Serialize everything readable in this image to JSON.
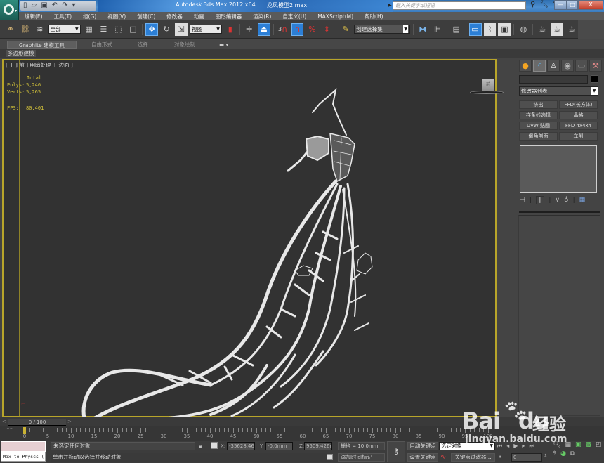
{
  "titlebar": {
    "window_title": "Autodesk 3ds Max  2012 x64",
    "document_title": "龙凤模型2.max",
    "search_placeholder": "键入关键字或短语",
    "quick_access": [
      "new-icon",
      "open-icon",
      "save-icon",
      "undo-icon",
      "redo-icon",
      "customize-icon"
    ],
    "info_icons": [
      "binoculars-icon",
      "wrench-icon",
      "exchange-icon",
      "star-icon",
      "help-icon"
    ],
    "window_controls": {
      "minimize": "—",
      "maximize": "□",
      "close": "X"
    }
  },
  "menu": [
    "编辑(E)",
    "工具(T)",
    "组(G)",
    "视图(V)",
    "创建(C)",
    "修改器",
    "动画",
    "图形编辑器",
    "渲染(R)",
    "自定义(U)",
    "MAXScript(M)",
    "帮助(H)"
  ],
  "toolbar": {
    "selection_filter": "全部",
    "reference_coord": "视图",
    "named_selection": "创建选择集",
    "snap_label": "3"
  },
  "ribbon": {
    "tabs": [
      "Graphite 建模工具",
      "自由形式",
      "选择",
      "对象绘制"
    ],
    "panel_label": "多边形建模"
  },
  "viewport": {
    "label": "[ + ] 前 ] 明暗处理 + 边面 ]",
    "stats": {
      "header": "Total",
      "polys_label": "Polys:",
      "polys": "5,246",
      "verts_label": "Verts:",
      "verts": "5,265",
      "fps_label": "FPS:",
      "fps": "80.401"
    },
    "viewcube_face": "前",
    "model": "dragon-phoenix wireframe"
  },
  "command_panel": {
    "tabs": [
      "create-icon",
      "modify-icon",
      "hierarchy-icon",
      "motion-icon",
      "display-icon",
      "utilities-icon"
    ],
    "object_name": "",
    "modifier_list": "修改器列表",
    "modifier_buttons": [
      "挤出",
      "FFD(长方体)",
      "样条线选择",
      "晶格",
      "UVW 贴图",
      "FFD 4x4x4",
      "倒角剖面",
      "车削"
    ],
    "stack_tools": [
      "pin-stack-icon",
      "show-end-result-icon",
      "make-unique-icon",
      "remove-modifier-icon",
      "configure-sets-icon"
    ]
  },
  "time_slider": {
    "label": "0 / 100",
    "current": 0,
    "total": 100
  },
  "trackbar": {
    "ticks": [
      "0",
      "5",
      "10",
      "15",
      "20",
      "25",
      "30",
      "35",
      "40",
      "45",
      "50",
      "55",
      "60",
      "65",
      "70",
      "75",
      "80",
      "85",
      "90",
      "95",
      "100"
    ]
  },
  "status": {
    "maxscript_text": "Max to Physcs (",
    "selection_status": "未选定任何对象",
    "prompt": "单击并拖动以选择并移动对象",
    "x_label": "X:",
    "x_value": "-35628.46",
    "y_label": "Y:",
    "y_value": "-0.0mm",
    "z_label": "Z:",
    "z_value": "9509.426m",
    "grid": "栅格 = 10.0mm",
    "add_time_tag": "添加时间标记",
    "auto_key": "自动关键点",
    "set_key": "设置关键点",
    "selected_dropdown": "选定对象",
    "key_filters": "关键点过滤器...",
    "current_frame": "0"
  },
  "watermark": {
    "brand": "Bai",
    "brand2": "du",
    "cn": "经验",
    "url": "jingyan.baidu.com"
  }
}
